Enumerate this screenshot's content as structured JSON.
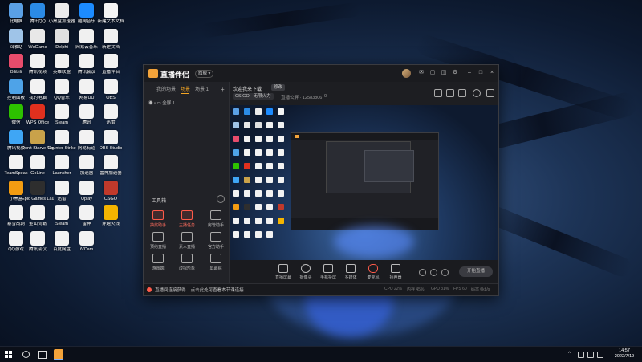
{
  "desktop": {
    "icons": [
      {
        "label": "此电脑",
        "color": "#5aa0e6"
      },
      {
        "label": "腾讯QQ",
        "color": "#2b8be6"
      },
      {
        "label": "小黑盒加速器",
        "color": "#ececec"
      },
      {
        "label": "酷狗音乐",
        "color": "#1c8bff"
      },
      {
        "label": "新建文本文档",
        "color": "#f4f4f4"
      },
      {
        "label": "回收站",
        "color": "#9fc4e8"
      },
      {
        "label": "WeGame",
        "color": "#e8e8e8"
      },
      {
        "label": "Delphi",
        "color": "#e0e0e0"
      },
      {
        "label": "网易云音乐",
        "color": "#f0f0f0"
      },
      {
        "label": "新建文档",
        "color": "#f0f0f0"
      },
      {
        "label": "Bilibili",
        "color": "#e74c6c"
      },
      {
        "label": "腾讯视频",
        "color": "#f2f2f2"
      },
      {
        "label": "英雄联盟",
        "color": "#f2f2f2"
      },
      {
        "label": "腾讯会议",
        "color": "#f2f2f2"
      },
      {
        "label": "直播伴侣",
        "color": "#f2f2f2"
      },
      {
        "label": "控制面板",
        "color": "#4ea3e8"
      },
      {
        "label": "我的电脑",
        "color": "#f2f2f2"
      },
      {
        "label": "QQ音乐",
        "color": "#f2f2f2"
      },
      {
        "label": "网易UU",
        "color": "#f2f2f2"
      },
      {
        "label": "OBS",
        "color": "#f2f2f2"
      },
      {
        "label": "微信",
        "color": "#2dc100"
      },
      {
        "label": "WPS Office",
        "color": "#e0301e"
      },
      {
        "label": "Steam",
        "color": "#f2f2f2"
      },
      {
        "label": "腾讯",
        "color": "#f2f2f2"
      },
      {
        "label": "迅雷",
        "color": "#f2f2f2"
      },
      {
        "label": "腾讯视频",
        "color": "#3fa6f5"
      },
      {
        "label": "Don't Starve Together",
        "color": "#c9a24a"
      },
      {
        "label": "Counter-Strike",
        "color": "#f2f2f2"
      },
      {
        "label": "网易有道",
        "color": "#f2f2f2"
      },
      {
        "label": "OBS Studio",
        "color": "#f2f2f2"
      },
      {
        "label": "TeamSpeak",
        "color": "#f2f2f2"
      },
      {
        "label": "GoLine",
        "color": "#f2f2f2"
      },
      {
        "label": "Launcher",
        "color": "#f2f2f2"
      },
      {
        "label": "加速器",
        "color": "#f2f2f2"
      },
      {
        "label": "雷神加速器",
        "color": "#f2f2f2"
      },
      {
        "label": "小黑盒",
        "color": "#f39c12"
      },
      {
        "label": "Epic Games Launcher",
        "color": "#2e2e2e"
      },
      {
        "label": "迅雷",
        "color": "#f2f2f2"
      },
      {
        "label": "Uplay",
        "color": "#f2f2f2"
      },
      {
        "label": "CSGO",
        "color": "#c0392b"
      },
      {
        "label": "暴雪战网",
        "color": "#f2f2f2"
      },
      {
        "label": "金山词霸",
        "color": "#f2f2f2"
      },
      {
        "label": "Steam",
        "color": "#f2f2f2"
      },
      {
        "label": "雷神",
        "color": "#f2f2f2"
      },
      {
        "label": "穿越火线",
        "color": "#f4b400"
      },
      {
        "label": "QQ游戏",
        "color": "#f2f2f2"
      },
      {
        "label": "腾讯会议",
        "color": "#f2f2f2"
      },
      {
        "label": "百度网盘",
        "color": "#f2f2f2"
      },
      {
        "label": "iVCam",
        "color": "#f2f2f2"
      }
    ]
  },
  "app": {
    "title": "直播伴侣",
    "version_badge": "旗舰 ▾",
    "scene_tabs": [
      "我的场景",
      "场景",
      "场景 1"
    ],
    "layer_name": "全屏 1",
    "tools_header": "工具箱",
    "tools": [
      {
        "label": "抽奖助手",
        "hot": true
      },
      {
        "label": "主播任务",
        "hot": true
      },
      {
        "label": "房管助手",
        "hot": false
      },
      {
        "label": "预约直播",
        "hot": false
      },
      {
        "label": "素人直播",
        "hot": false
      },
      {
        "label": "官方助手",
        "hot": false
      },
      {
        "label": "游戏端",
        "hot": false
      },
      {
        "label": "虚拟形象",
        "hot": false
      },
      {
        "label": "屏幕贴",
        "hot": false
      }
    ],
    "room_title": "欢迎我来下载",
    "edit_label": "修改",
    "category": "CS:GO · 无限火力",
    "room_number": "直播公屏 · 12583806",
    "likes": "0",
    "controls": [
      {
        "label": "直播屏幕"
      },
      {
        "label": "摄像头"
      },
      {
        "label": "手机投屏"
      },
      {
        "label": "多媒体"
      },
      {
        "label": "麦克风"
      },
      {
        "label": "扬声器"
      }
    ],
    "start_button": "开始直播",
    "status_message": "直播间连接获得... 点击此处可查看本节课连接",
    "metrics": [
      "CPU 22%",
      "内存 45%",
      "GPU 31%",
      "FPS 60",
      "码率 0kb/s"
    ]
  },
  "taskbar": {
    "time": "14:57",
    "date": "2022/7/19"
  }
}
